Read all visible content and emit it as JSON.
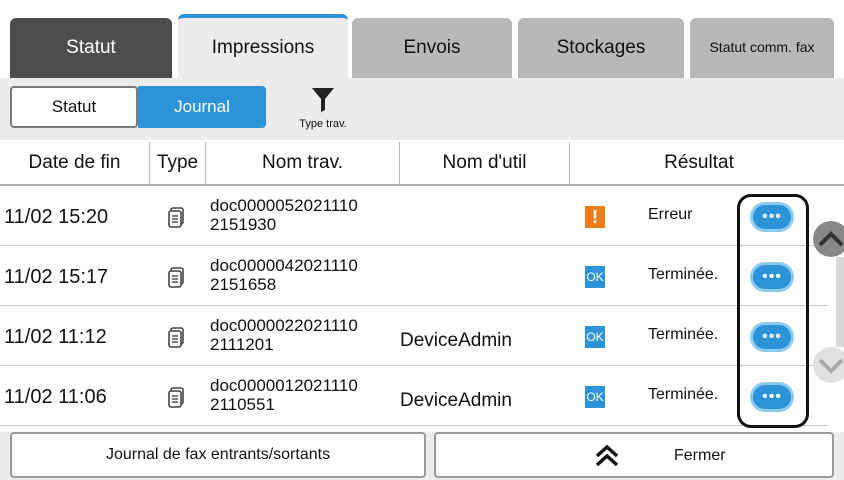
{
  "tabs": {
    "statut": "Statut",
    "impressions": "Impressions",
    "envois": "Envois",
    "stockages": "Stockages",
    "statut_fax": "Statut comm. fax"
  },
  "toolbar": {
    "statut_label": "Statut",
    "journal_label": "Journal",
    "filter_label": "Type trav.",
    "selected_view": "Journal"
  },
  "table": {
    "headers": [
      "Date de fin",
      "Type",
      "Nom trav.",
      "Nom d'util",
      "Résultat"
    ],
    "rows": [
      {
        "date": "11/02 15:20",
        "name1": "doc0000052021110",
        "name2": "2151930",
        "user": "",
        "status_icon": "!",
        "status_type": "error",
        "result": "Erreur",
        "more": "•••"
      },
      {
        "date": "11/02 15:17",
        "name1": "doc0000042021110",
        "name2": "2151658",
        "user": "",
        "status_icon": "OK",
        "status_type": "ok",
        "result": "Terminée.",
        "more": "•••"
      },
      {
        "date": "11/02 11:12",
        "name1": "doc0000022021110",
        "name2": "2111201",
        "user": "DeviceAdmin",
        "status_icon": "OK",
        "status_type": "ok",
        "result": "Terminée.",
        "more": "•••"
      },
      {
        "date": "11/02 11:06",
        "name1": "doc0000012021110",
        "name2": "2110551",
        "user": "DeviceAdmin",
        "status_icon": "OK",
        "status_type": "ok",
        "result": "Terminée.",
        "more": "•••"
      }
    ]
  },
  "bottom": {
    "fax_log_label": "Journal de fax entrants/sortants",
    "close_label": "Fermer"
  },
  "colors": {
    "accent": "#2b93d6",
    "error": "#f07d1b",
    "active_tab_dark": "#4d4d4d",
    "inactive_tab": "#b8b8b8"
  },
  "icons": {
    "filter": "funnel-icon",
    "doc": "document-icon",
    "scroll_up": "chevron-up-icon",
    "scroll_down": "chevron-down-icon",
    "close": "double-chevron-up-icon"
  }
}
